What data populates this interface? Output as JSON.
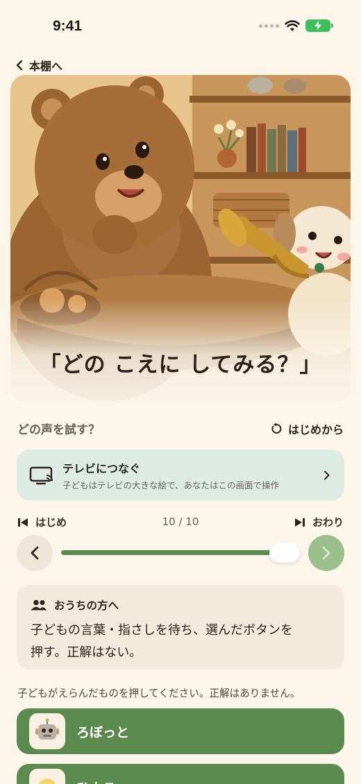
{
  "status_bar": {
    "time": "9:41"
  },
  "nav": {
    "back_label": "本棚へ"
  },
  "hero": {
    "caption": "「どの こえに してみる？」"
  },
  "voice": {
    "label": "どの声を試す？",
    "restart_label": "はじめから"
  },
  "tv": {
    "title": "テレビにつなぐ",
    "subtitle": "子どもはテレビの大きな絵で、あなたはこの画面で操作"
  },
  "pager": {
    "start_label": "はじめ",
    "end_label": "おわり",
    "counter": "10 / 10",
    "progress": 1.0
  },
  "parent_note": {
    "title": "おうちの方へ",
    "body_line1": "子どもの言葉・指さしを待ち、選んだボタンを",
    "body_line2": "押す。正解はない。"
  },
  "instruction": "子どもがえらんだものを押してください。正解はありません。",
  "choices": [
    {
      "label": "ろぼっと",
      "icon": "robot-icon"
    },
    {
      "label": "ひよこ",
      "icon": "chick-icon"
    }
  ],
  "colors": {
    "background": "#fbf5ea",
    "accent_green": "#5b8a4e",
    "tv_card": "#deebe4",
    "parent_card": "#f3eadc"
  }
}
